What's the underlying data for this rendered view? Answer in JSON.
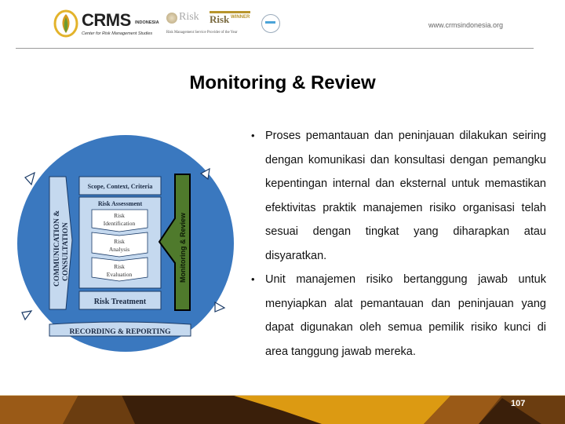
{
  "header": {
    "logo": {
      "name": "CRMS",
      "sub": "INDONESIA",
      "tagline": "Center for Risk Management Studies"
    },
    "awards": {
      "award1": "Risk",
      "award2": "Risk",
      "winner": "WINNER",
      "caption": "Risk Management Service Provider of the Year"
    },
    "url": "www.crmsindonesia.org"
  },
  "title": "Monitoring & Review",
  "diagram": {
    "communication": [
      "COMMUNICATION &",
      "CONSULTATION"
    ],
    "scope": "Scope, Context, Criteria",
    "assessment": "Risk Assessment",
    "identification": [
      "Risk",
      "Identification"
    ],
    "analysis": [
      "Risk",
      "Analysis"
    ],
    "evaluation": [
      "Risk",
      "Evaluation"
    ],
    "treatment": "Risk Treatment",
    "monitoring": "Monitoring & Review",
    "recording": "RECORDING & REPORTING",
    "colors": {
      "circle": "#3a78bf",
      "panel": "#c5d9ef",
      "monitoring": "#4f7a2c"
    }
  },
  "bullets": [
    "Proses pemantauan dan peninjauan dilakukan seiring dengan komunikasi dan konsultasi dengan pemangku kepentingan internal dan eksternal untuk memastikan efektivitas praktik manajemen risiko organisasi telah sesuai dengan tingkat yang diharapkan atau disyaratkan.",
    "Unit manajemen risiko bertanggung jawab untuk menyiapkan alat pemantauan dan peninjauan yang dapat digunakan oleh semua pemilik risiko kunci di area tanggung jawab mereka."
  ],
  "footer": {
    "page_number": "107"
  }
}
